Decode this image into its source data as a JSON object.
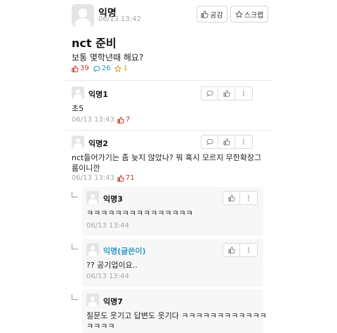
{
  "post": {
    "author": "익명",
    "time": "06/13 13:42",
    "like_label": "공감",
    "scrap_label": "스크랩",
    "title": "nct 준비",
    "body": "보통 몇학년때 해요?",
    "likes": "39",
    "comments": "26",
    "scraps": "1"
  },
  "comments": [
    {
      "author": "익명1",
      "text": "초5",
      "time": "06/13 13:43",
      "likes": "7"
    },
    {
      "author": "익명2",
      "text_line1": "nct들어가기는 좀 늦지 않았나? 뭐 혹시 모르지 무한확장그",
      "text_line2": "룹이니깐",
      "time": "06/13 13:43",
      "likes": "71"
    }
  ],
  "replies": [
    {
      "author": "익명3",
      "text": "ㅋㅋㅋㅋㅋㅋㅋㅋㅋㅋㅋㅋㅋㅋㅋ",
      "time": "06/13 13:44"
    },
    {
      "author": "익명(글쓴이)",
      "text": "?? 공기업이요..",
      "time": "06/13 13:44"
    },
    {
      "author": "익명7",
      "text_line1": "질문도 웃기고 답변도 웃기다 ㅋㅋㅋㅋㅋㅋㅋㅋㅋㅋㅋㅋ",
      "text_line2": "ㅋㅋㅋㅋ"
    }
  ],
  "colors": {
    "like": "#c0392b",
    "comment": "#2e9bc7",
    "scrap": "#d4a017",
    "writer": "#2e9bc7"
  },
  "icons": [
    "thumbs-up-icon",
    "star-icon",
    "speech-bubble-icon",
    "more-vertical-icon",
    "reply-arrow-icon",
    "avatar-icon"
  ]
}
